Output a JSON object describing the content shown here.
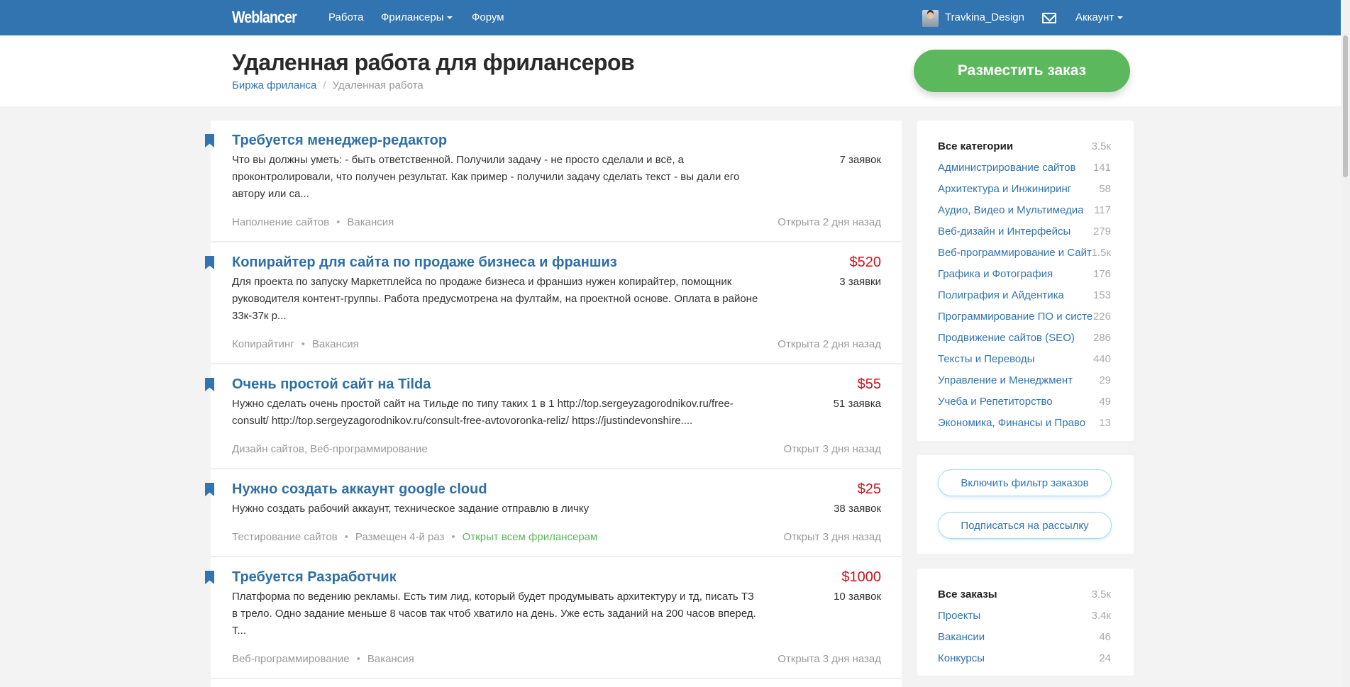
{
  "nav": {
    "logo": "Weblancer",
    "links": [
      "Работа",
      "Фрилансеры",
      "Форум"
    ],
    "user": "Travkina_Design",
    "account": "Аккаунт"
  },
  "header": {
    "title": "Удаленная работа для фрилансеров",
    "breadcrumbs": [
      "Биржа фриланса",
      "Удаленная работа"
    ],
    "cta": "Разместить заказ"
  },
  "jobs": [
    {
      "title": "Требуется менеджер-редактор",
      "price": "",
      "bids": "7 заявок",
      "desc": "Что вы должны уметь: - быть ответственной. Получили задачу - не просто сделали и всё, а проконтролировали, что получен результат. Как пример - получили задачу сделать текст - вы дали его автору или са...",
      "meta": [
        "Наполнение сайтов",
        "Вакансия"
      ],
      "green": "",
      "time": "Открыта 2 дня назад"
    },
    {
      "title": "Копирайтер для сайта по продаже бизнеса и франшиз",
      "price": "$520",
      "bids": "3 заявки",
      "desc": "Для проекта по запуску Маркетплейса по продаже бизнеса и франшиз нужен копирайтер, помощник руководителя контент-группы. Работа предусмотрена на фултайм, на проектной основе. Оплата в районе 33к-37к р...",
      "meta": [
        "Копирайтинг",
        "Вакансия"
      ],
      "green": "",
      "time": "Открыта 2 дня назад"
    },
    {
      "title": "Очень простой сайт на Tilda",
      "price": "$55",
      "bids": "51 заявка",
      "desc": "Нужно сделать очень простой сайт на Тильде по типу таких 1 в 1 http://top.sergeyzagorodnikov.ru/free-consult/ http://top.sergeyzagorodnikov.ru/consult-free-avtovoronka-reliz/ https://justindevonshire....",
      "meta": [
        "Дизайн сайтов, Веб-программирование"
      ],
      "green": "",
      "time": "Открыт 3 дня назад"
    },
    {
      "title": "Нужно создать аккаунт google cloud",
      "price": "$25",
      "bids": "38 заявок",
      "desc": "Нужно создать рабочий аккаунт, техническое задание отправлю в личку",
      "meta": [
        "Тестирование сайтов",
        "Размещен 4-й раз"
      ],
      "green": "Открыт всем фрилансерам",
      "time": "Открыт 3 дня назад"
    },
    {
      "title": "Требуется Разработчик",
      "price": "$1000",
      "bids": "10 заявок",
      "desc": "Платформа по ведению рекламы. Есть тим лид, который будет продумывать архитектуру и тд, писать ТЗ в трело. Одно задание меньше 8 часов так чтоб хватило на день. Уже есть заданий на 200 часов вперед. Т...",
      "meta": [
        "Веб-программирование",
        "Вакансия"
      ],
      "green": "",
      "time": "Открыта 3 дня назад"
    },
    {
      "title": "Адекватная верстка",
      "price": "",
      "bids": "",
      "desc": "",
      "meta": [],
      "green": "",
      "time": ""
    }
  ],
  "categories": [
    [
      "Все категории",
      "3.5к"
    ],
    [
      "Администрирование сайтов",
      "141"
    ],
    [
      "Архитектура и Инжиниринг",
      "58"
    ],
    [
      "Аудио, Видео и Мультимедиа",
      "117"
    ],
    [
      "Веб-дизайн и Интерфейсы",
      "279"
    ],
    [
      "Веб-программирование и Сайты",
      "1.5к"
    ],
    [
      "Графика и Фотография",
      "176"
    ],
    [
      "Полиграфия и Айдентика",
      "153"
    ],
    [
      "Программирование ПО и систем",
      "226"
    ],
    [
      "Продвижение сайтов (SEO)",
      "286"
    ],
    [
      "Тексты и Переводы",
      "440"
    ],
    [
      "Управление и Менеджмент",
      "29"
    ],
    [
      "Учеба и Репетиторство",
      "49"
    ],
    [
      "Экономика, Финансы и Право",
      "13"
    ]
  ],
  "actions": {
    "filter": "Включить фильтр заказов",
    "subscribe": "Подписаться на рассылку"
  },
  "orders": [
    [
      "Все заказы",
      "3.5к"
    ],
    [
      "Проекты",
      "3.4к"
    ],
    [
      "Вакансии",
      "46"
    ],
    [
      "Конкурсы",
      "24"
    ]
  ],
  "colors": {
    "brand": "#3274b0",
    "cta": "#5cb85c",
    "price": "#d0121b"
  }
}
